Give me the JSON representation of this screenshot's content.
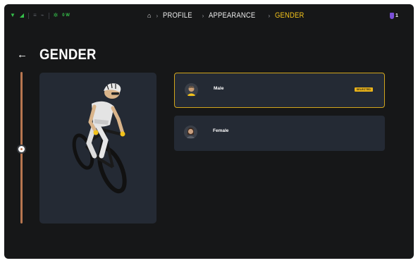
{
  "status": {
    "wifi_icon": "wifi-icon",
    "speed_label": "0 W"
  },
  "breadcrumb": {
    "home_icon": "home-icon",
    "items": [
      "PROFILE",
      "APPEARANCE",
      "GENDER"
    ]
  },
  "badge": {
    "icon": "shield-icon",
    "count": "1"
  },
  "page": {
    "title": "GENDER",
    "back_icon": "arrow-left-icon"
  },
  "options": [
    {
      "label": "Male",
      "selected": true,
      "selected_label": "SELECTED"
    },
    {
      "label": "Female",
      "selected": false
    }
  ],
  "colors": {
    "background": "#161718",
    "panel": "#242a34",
    "accent": "#f2c21b",
    "slider": "#b87650"
  }
}
